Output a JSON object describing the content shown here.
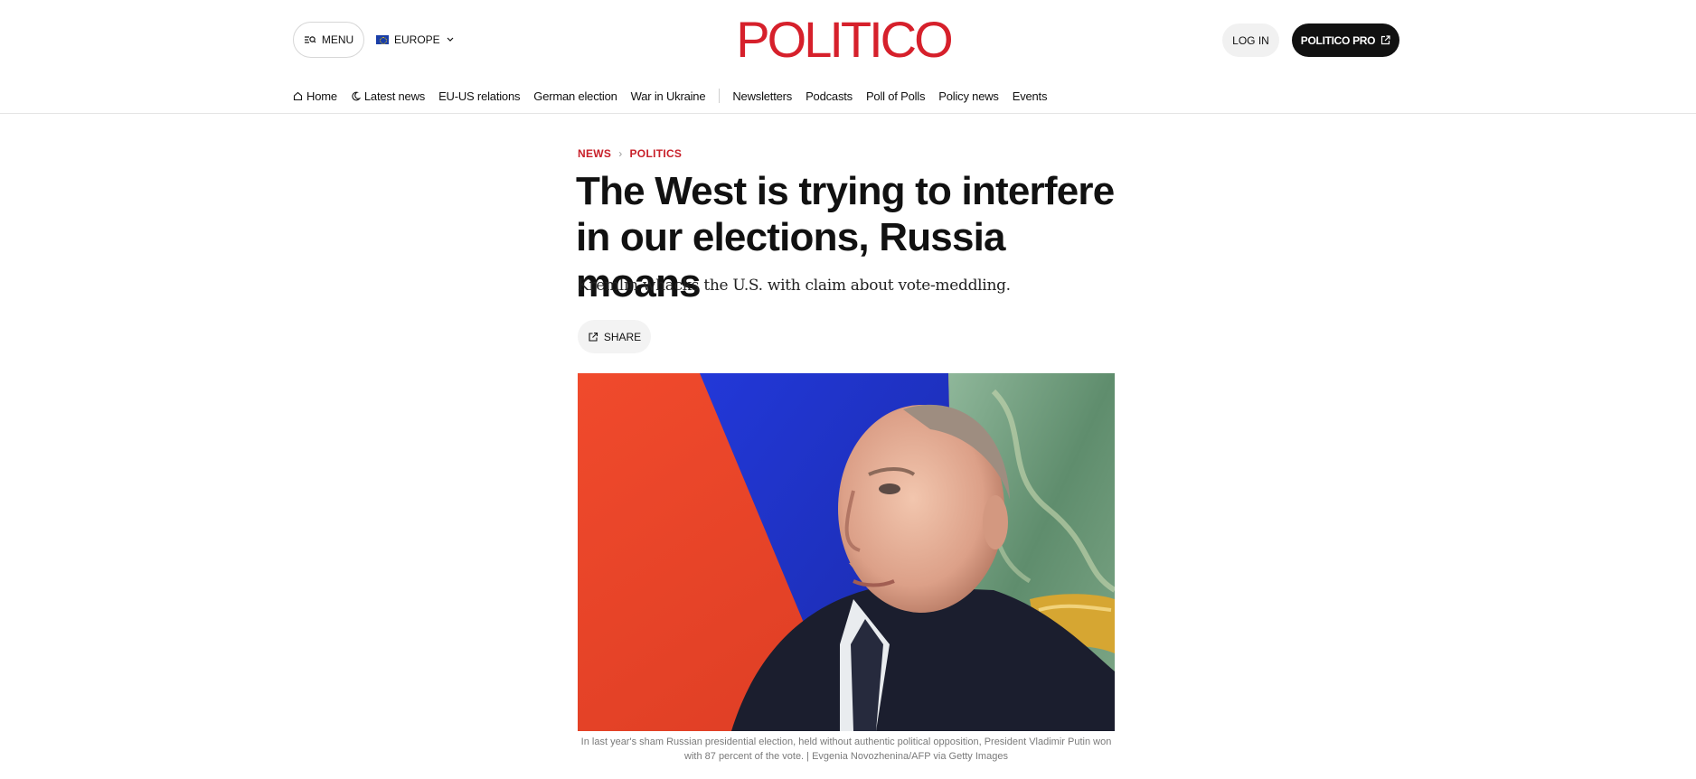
{
  "header": {
    "menu_label": "MENU",
    "edition_label": "EUROPE",
    "logo_text": "POLITICO",
    "login_label": "LOG IN",
    "pro_label": "POLITICO PRO",
    "brand_color": "#d6202b"
  },
  "nav": {
    "items": [
      {
        "label": "Home",
        "icon": "home-icon"
      },
      {
        "label": "Latest news",
        "icon": "moon-icon"
      },
      {
        "label": "EU-US relations"
      },
      {
        "label": "German election"
      },
      {
        "label": "War in Ukraine"
      },
      {
        "label": "Newsletters"
      },
      {
        "label": "Podcasts"
      },
      {
        "label": "Poll of Polls"
      },
      {
        "label": "Policy news"
      },
      {
        "label": "Events"
      }
    ]
  },
  "article": {
    "breadcrumbs": [
      "NEWS",
      "POLITICS"
    ],
    "headline": "The West is trying to interfere in our elections, Russia moans",
    "dek": "Kremlin whacks the U.S. with claim about vote-meddling.",
    "share_label": "SHARE",
    "image_alt": "Vladimir Putin in front of a Russian flag",
    "caption": "In last year's sham Russian presidential election, held without authentic political opposition, President Vladimir Putin won with 87 percent of the vote. | Evgenia Novozhenina/AFP via Getty Images"
  }
}
